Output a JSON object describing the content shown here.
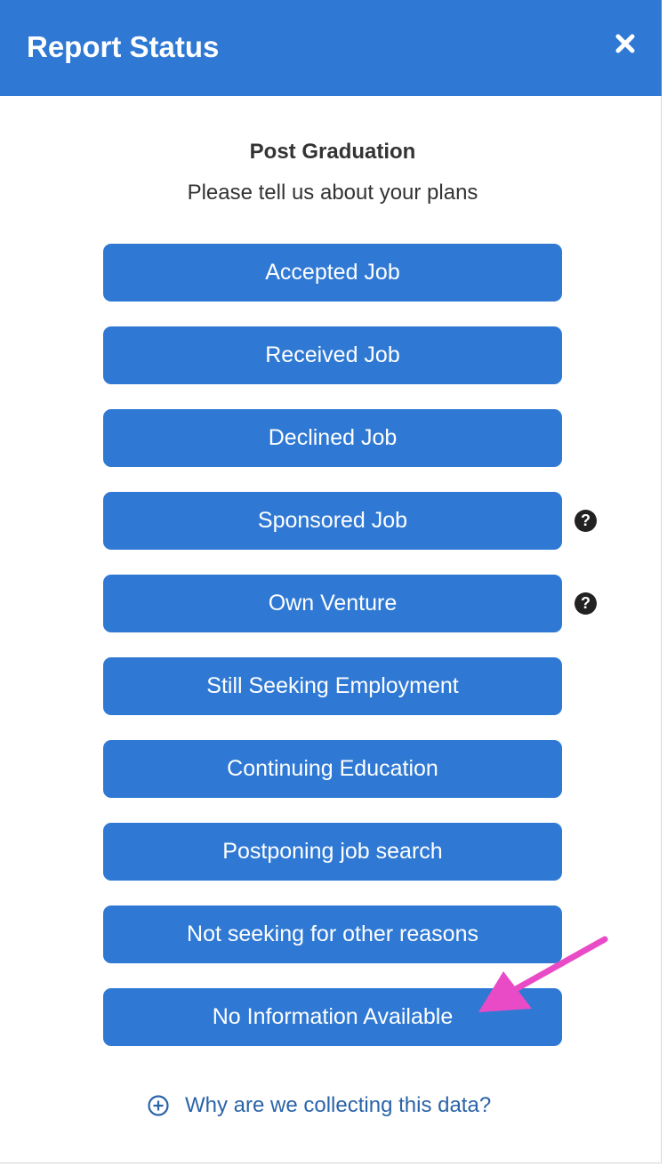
{
  "header": {
    "title": "Report Status",
    "close_icon": "close-icon"
  },
  "content": {
    "heading": "Post Graduation",
    "subheading": "Please tell us about your plans"
  },
  "options": [
    {
      "label": "Accepted Job",
      "has_help": false
    },
    {
      "label": "Received Job",
      "has_help": false
    },
    {
      "label": "Declined Job",
      "has_help": false
    },
    {
      "label": "Sponsored Job",
      "has_help": true,
      "help_glyph": "?"
    },
    {
      "label": "Own Venture",
      "has_help": true,
      "help_glyph": "?"
    },
    {
      "label": "Still Seeking Employment",
      "has_help": false
    },
    {
      "label": "Continuing Education",
      "has_help": false
    },
    {
      "label": "Postponing job search",
      "has_help": false
    },
    {
      "label": "Not seeking for other reasons",
      "has_help": false
    },
    {
      "label": "No Information Available",
      "has_help": false
    }
  ],
  "footer": {
    "link_text": "Why are we collecting this data?",
    "link_icon": "plus-circle-icon"
  },
  "annotation": {
    "arrow_icon": "pointer-arrow-icon",
    "target": "No Information Available"
  },
  "colors": {
    "header_bg": "#2f79d4",
    "button_bg": "#2f79d4",
    "link_color": "#2a64a8",
    "arrow_color": "#e94bc6"
  }
}
